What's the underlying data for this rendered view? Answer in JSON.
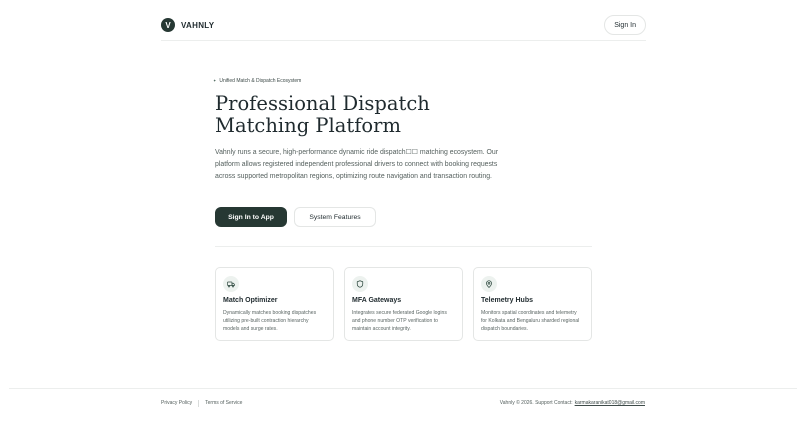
{
  "header": {
    "brand_initial": "V",
    "brand_name": "VAHNLY",
    "sign_in_label": "Sign In"
  },
  "hero": {
    "eyebrow": "Unified Match & Dispatch Ecosystem",
    "title_line1": "Professional Dispatch",
    "title_line2": "Matching Platform",
    "description": "Vahnly runs a secure, high-performance dynamic ride dispatch☐☐ matching ecosystem. Our platform allows registered independent professional drivers to connect with booking requests across supported metropolitan regions, optimizing route navigation and transaction routing.",
    "primary_button": "Sign In to App",
    "secondary_button": "System Features"
  },
  "features": [
    {
      "icon": "truck-icon",
      "title": "Match Optimizer",
      "description": "Dynamically matches booking dispatches utilizing pre-built contraction hierarchy models and surge rates."
    },
    {
      "icon": "shield-icon",
      "title": "MFA Gateways",
      "description": "Integrates secure federated Google logins and phone number OTP verification to maintain account integrity."
    },
    {
      "icon": "map-pin-icon",
      "title": "Telemetry Hubs",
      "description": "Monitors spatial coordinates and telemetry for Kolkata and Bengaluru sharded regional dispatch boundaries."
    }
  ],
  "footer": {
    "privacy": "Privacy Policy",
    "terms": "Terms of Service",
    "copyright": "Vahnly © 2026. Support Contact:",
    "email": "karmakaranikat018@gmail.com"
  },
  "colors": {
    "brand_dark": "#263833",
    "icon_bg": "#edf2ef",
    "border": "#e4e6e5"
  }
}
